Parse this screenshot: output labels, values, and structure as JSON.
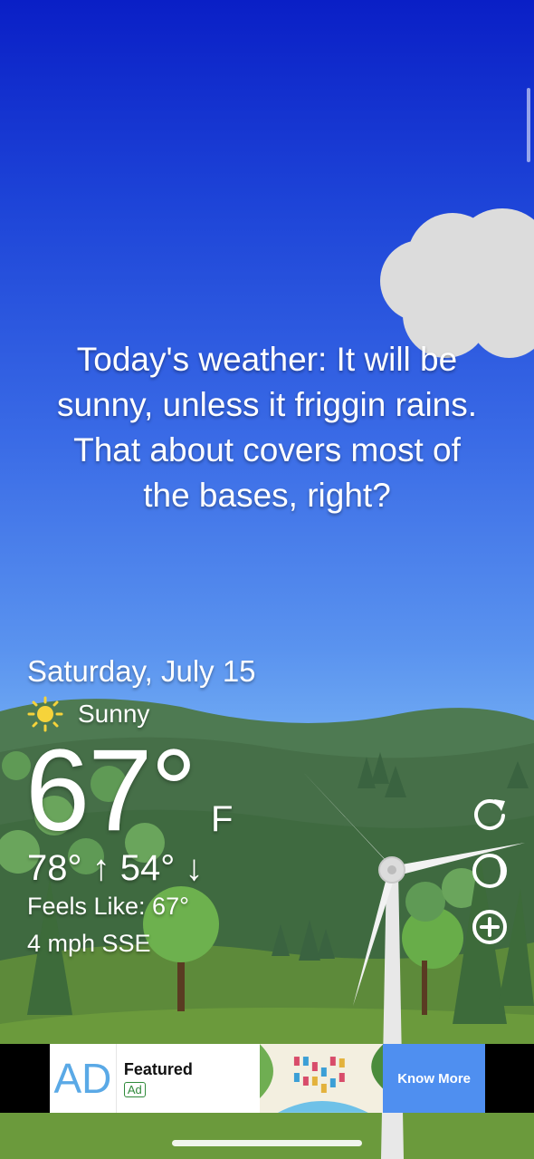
{
  "quote": {
    "line1": "Today's weather: It will be",
    "line2": "sunny, unless it friggin rains.",
    "line3": "That about covers most of",
    "line4": "the bases, right?"
  },
  "weather": {
    "date": "Saturday, July 15",
    "condition": "Sunny",
    "condition_icon": "sun-icon",
    "temperature": "67°",
    "unit": "F",
    "high_low": "78° ↑ 54° ↓",
    "feels_like": "Feels Like: 67°",
    "wind": "4 mph SSE"
  },
  "controls": {
    "refresh_icon": "refresh-icon",
    "moon_icon": "moon-phase-icon",
    "add_icon": "add-circle-icon"
  },
  "ad": {
    "logo": "AD",
    "title": "Featured",
    "badge": "Ad",
    "cta": "Know More"
  },
  "colors": {
    "sky_top": "#0a1fc6",
    "sky_bottom": "#86c0f6",
    "cta": "#4f8ff0"
  }
}
